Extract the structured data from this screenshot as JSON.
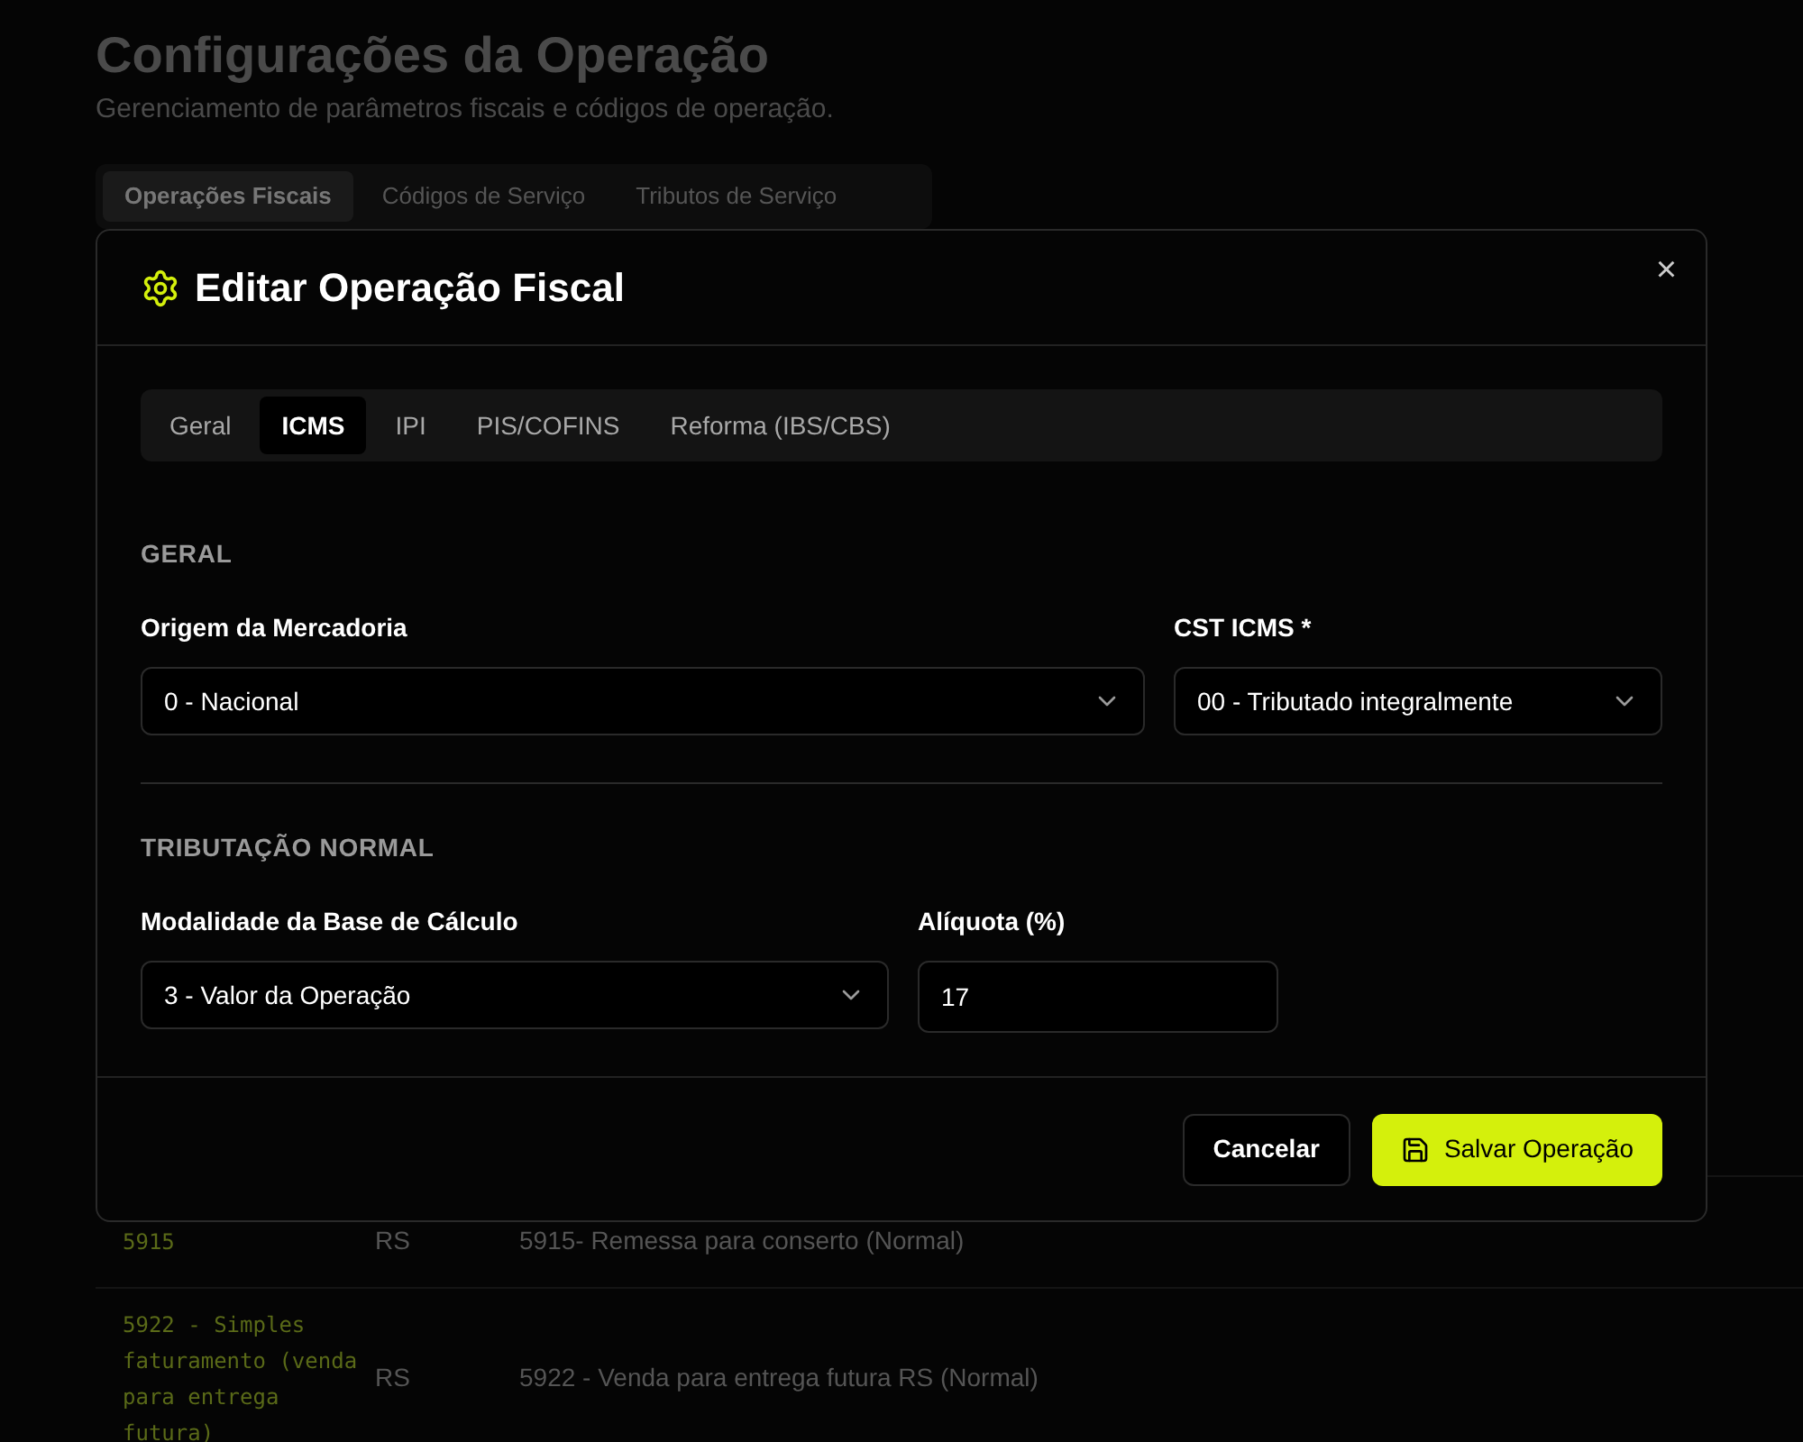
{
  "page": {
    "title": "Configurações da Operação",
    "subtitle": "Gerenciamento de parâmetros fiscais e códigos de operação."
  },
  "page_tabs": [
    {
      "label": "Operações Fiscais",
      "selected": true
    },
    {
      "label": "Códigos de Serviço",
      "selected": false
    },
    {
      "label": "Tributos de Serviço",
      "selected": false
    }
  ],
  "table": {
    "rows": [
      {
        "code": "5915",
        "uf": "RS",
        "description": "5915- Remessa para conserto (Normal)"
      },
      {
        "code": "5922 - Simples faturamento (venda para entrega futura)",
        "uf": "RS",
        "description": "5922 - Venda para entrega futura RS (Normal)"
      }
    ]
  },
  "dialog": {
    "title": "Editar Operação Fiscal",
    "close": "×",
    "tabs": [
      {
        "label": "Geral",
        "selected": false
      },
      {
        "label": "ICMS",
        "selected": true
      },
      {
        "label": "IPI",
        "selected": false
      },
      {
        "label": "PIS/COFINS",
        "selected": false
      },
      {
        "label": "Reforma (IBS/CBS)",
        "selected": false
      }
    ],
    "sections": [
      {
        "heading": "GERAL",
        "fields": [
          {
            "kind": "select",
            "label": "Origem da Mercadoria",
            "value": "0 - Nacional"
          },
          {
            "kind": "select",
            "label": "CST ICMS *",
            "value": "00 - Tributado integralmente"
          }
        ]
      },
      {
        "heading": "TRIBUTAÇÃO NORMAL",
        "fields": [
          {
            "kind": "select",
            "label": "Modalidade da Base de Cálculo",
            "value": "3 - Valor da Operação"
          },
          {
            "kind": "input",
            "label": "Alíquota (%)",
            "value": "17"
          }
        ]
      }
    ],
    "buttons": [
      {
        "kind": "secondary",
        "label": "Cancelar"
      },
      {
        "kind": "primary",
        "label": "Salvar Operação"
      }
    ]
  }
}
